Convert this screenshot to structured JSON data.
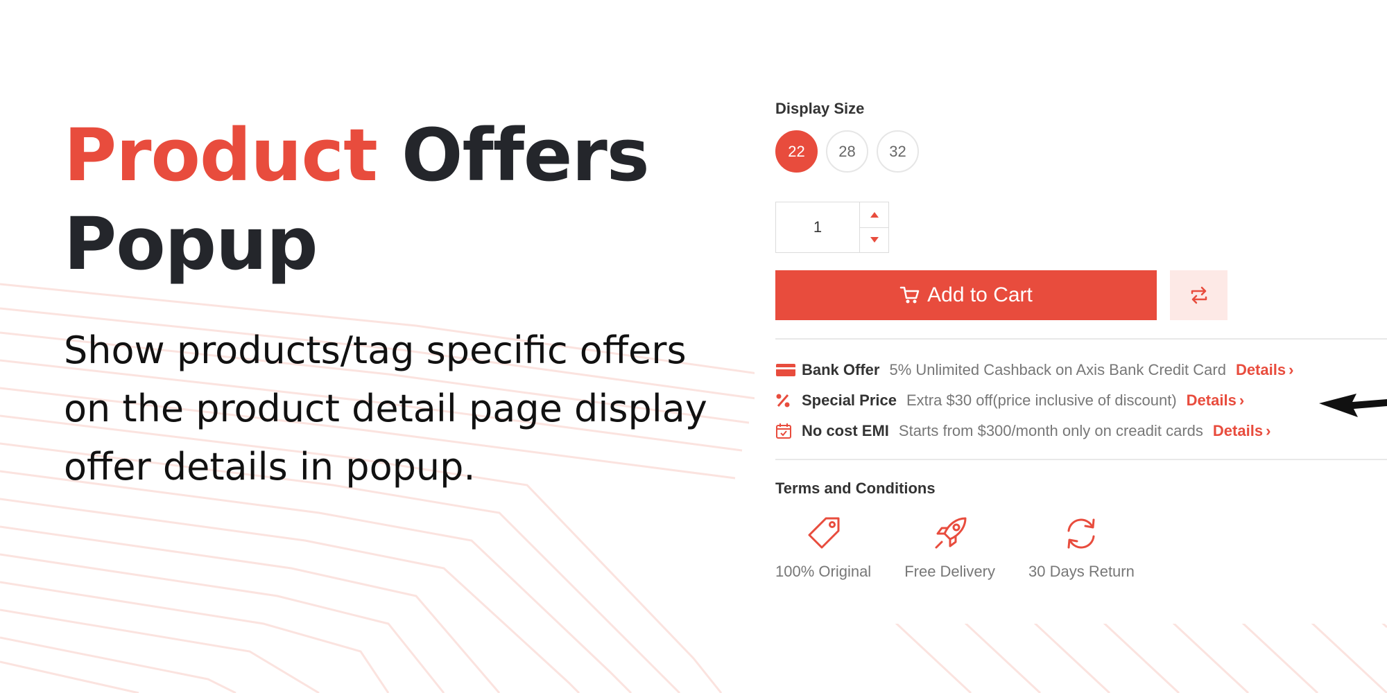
{
  "hero": {
    "title_accent": "Product",
    "title_rest_line1": "Offers",
    "title_line2": "Popup",
    "description": "Show products/tag specific offers on the product detail page display offer details in popup."
  },
  "product": {
    "display_size_label": "Display Size",
    "sizes": [
      "22",
      "28",
      "32"
    ],
    "selected_size": "22",
    "quantity": "1",
    "add_to_cart_label": "Add to Cart"
  },
  "offers": [
    {
      "icon": "credit-card-icon",
      "title": "Bank Offer",
      "text": "5% Unlimited Cashback on Axis Bank Credit Card",
      "link": "Details"
    },
    {
      "icon": "percent-icon",
      "title": "Special Price",
      "text": "Extra $30 off(price inclusive of discount)",
      "link": "Details"
    },
    {
      "icon": "calendar-icon",
      "title": "No cost EMI",
      "text": "Starts from $300/month only on creadit cards",
      "link": "Details"
    }
  ],
  "terms_label": "Terms and Conditions",
  "features": [
    {
      "icon": "tag-icon",
      "label": "100% Original"
    },
    {
      "icon": "rocket-icon",
      "label": "Free Delivery"
    },
    {
      "icon": "return-icon",
      "label": "30 Days Return"
    }
  ],
  "colors": {
    "accent": "#e84c3d",
    "dark": "#24262b",
    "light_accent": "#fde9e6"
  }
}
